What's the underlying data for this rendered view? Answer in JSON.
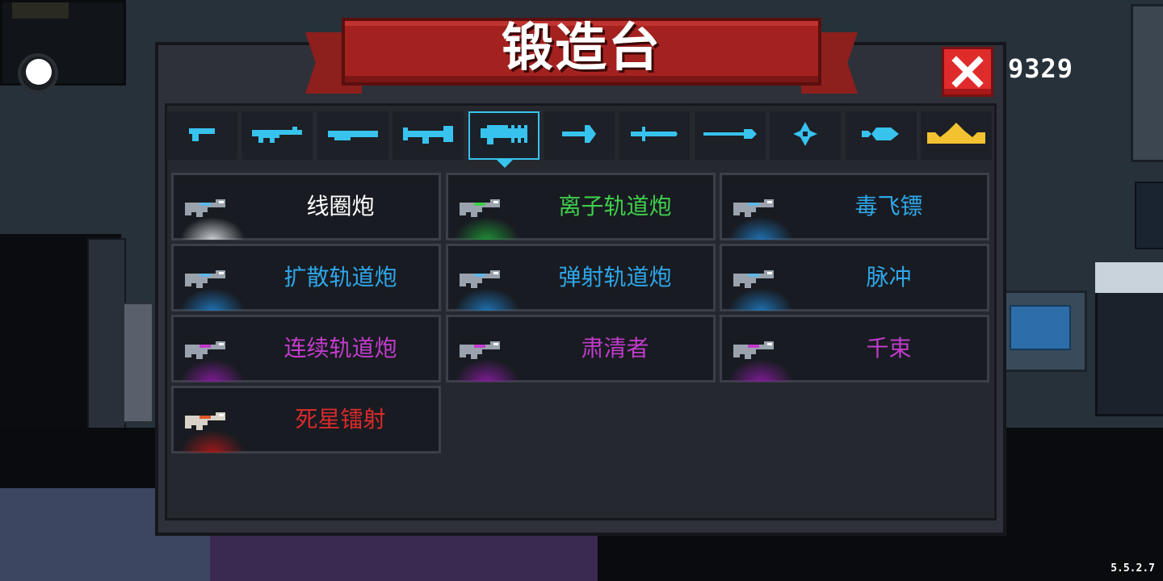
{
  "hud": {
    "coins": "9329",
    "version": "5.5.2.7"
  },
  "forge": {
    "title": "锻造台",
    "close_icon": "close-x-icon",
    "tabs": [
      {
        "icon": "pistol-icon",
        "active": false
      },
      {
        "icon": "assault-rifle-icon",
        "active": false
      },
      {
        "icon": "shotgun-icon",
        "active": false
      },
      {
        "icon": "launcher-icon",
        "active": false
      },
      {
        "icon": "laser-gun-icon",
        "active": true
      },
      {
        "icon": "bow-arrow-icon",
        "active": false
      },
      {
        "icon": "sword-icon",
        "active": false
      },
      {
        "icon": "spear-icon",
        "active": false
      },
      {
        "icon": "shuriken-icon",
        "active": false
      },
      {
        "icon": "fish-icon",
        "active": false
      },
      {
        "icon": "crown-icon",
        "active": false
      }
    ],
    "colors": {
      "tab_icon": "#37c3ee",
      "crown_icon": "#f2c230",
      "white": "#ffffff",
      "green": "#3fce4d",
      "blue": "#2ea6e8",
      "purple": "#c23ccc",
      "red": "#d92b2b"
    },
    "weapons": [
      {
        "name": "线圈炮",
        "rarity": "white"
      },
      {
        "name": "离子轨道炮",
        "rarity": "green"
      },
      {
        "name": "毒飞镖",
        "rarity": "blue"
      },
      {
        "name": "扩散轨道炮",
        "rarity": "blue"
      },
      {
        "name": "弹射轨道炮",
        "rarity": "blue"
      },
      {
        "name": "脉冲",
        "rarity": "blue"
      },
      {
        "name": "连续轨道炮",
        "rarity": "purple"
      },
      {
        "name": "肃清者",
        "rarity": "purple"
      },
      {
        "name": "千束",
        "rarity": "purple"
      },
      {
        "name": "死星镭射",
        "rarity": "red"
      }
    ]
  }
}
